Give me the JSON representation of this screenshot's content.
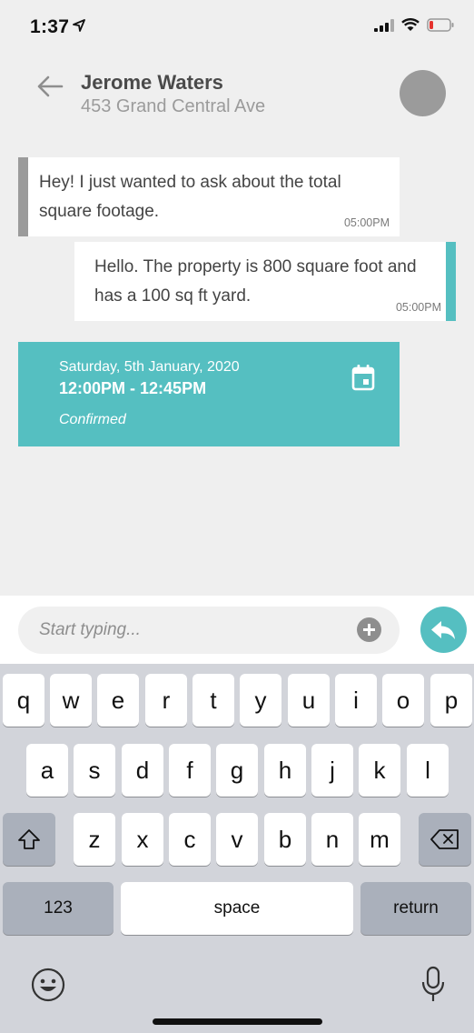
{
  "status_bar": {
    "time": "1:37"
  },
  "header": {
    "name": "Jerome Waters",
    "address": "453 Grand Central Ave"
  },
  "messages": [
    {
      "direction": "incoming",
      "text": "Hey! I just wanted to ask about the total square footage.",
      "time": "05:00PM"
    },
    {
      "direction": "outgoing",
      "text": "Hello. The property is 800 square foot and has a 100 sq ft yard.",
      "time": "05:00PM"
    }
  ],
  "appointment": {
    "date": "Saturday, 5th January, 2020",
    "time": "12:00PM - 12:45PM",
    "status": "Confirmed",
    "icon": "calendar-icon"
  },
  "composer": {
    "placeholder": "Start typing...",
    "add_icon": "plus-circle-icon",
    "send_icon": "reply-arrow-icon"
  },
  "keyboard": {
    "row1": [
      "q",
      "w",
      "e",
      "r",
      "t",
      "y",
      "u",
      "i",
      "o",
      "p"
    ],
    "row2": [
      "a",
      "s",
      "d",
      "f",
      "g",
      "h",
      "j",
      "k",
      "l"
    ],
    "row3": [
      "z",
      "x",
      "c",
      "v",
      "b",
      "n",
      "m"
    ],
    "numbers_label": "123",
    "space_label": "space",
    "return_label": "return",
    "shift_icon": "shift-icon",
    "backspace_icon": "backspace-icon",
    "emoji_icon": "emoji-icon",
    "mic_icon": "microphone-icon"
  },
  "colors": {
    "accent": "#55bfc1",
    "incoming_bar": "#9b9b9b",
    "background": "#efefef"
  }
}
